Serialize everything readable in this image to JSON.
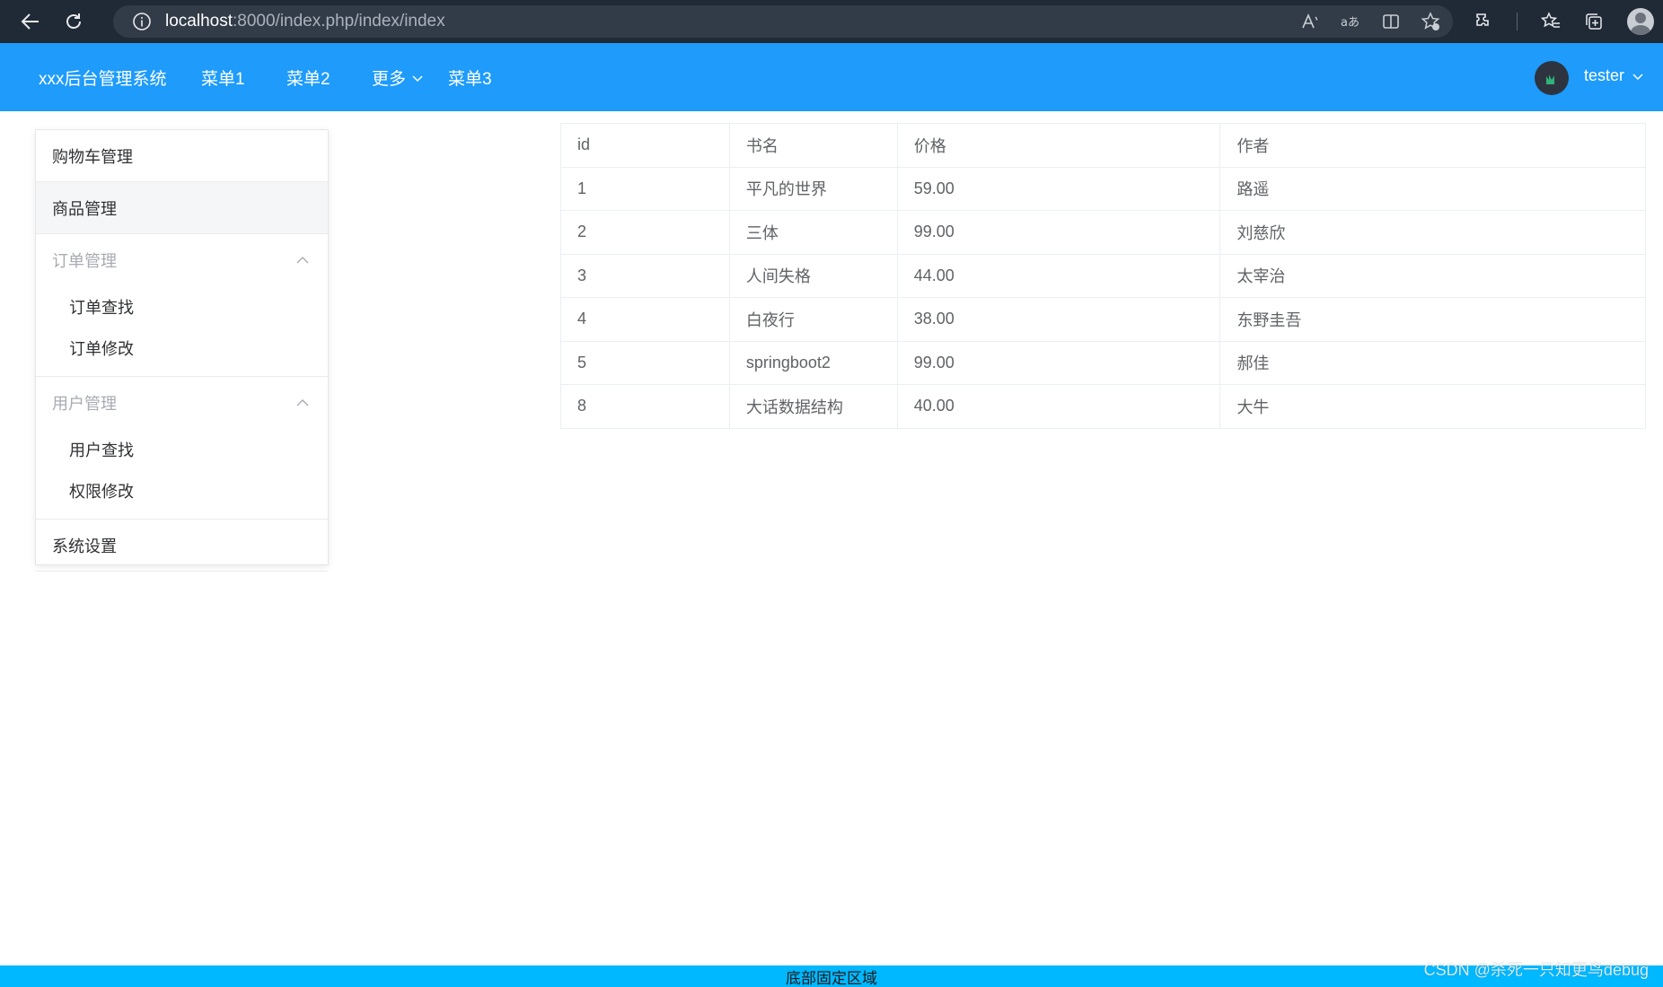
{
  "browser": {
    "url_host": "localhost",
    "url_rest": ":8000/index.php/index/index"
  },
  "header": {
    "brand": "xxx后台管理系统",
    "menu": [
      "菜单1",
      "菜单2",
      "更多",
      "菜单3"
    ],
    "username": "tester",
    "color": "#1e9bfb"
  },
  "sidebar": {
    "items": [
      {
        "label": "购物车管理"
      },
      {
        "label": "商品管理"
      }
    ],
    "groups": [
      {
        "title": "订单管理",
        "children": [
          "订单查找",
          "订单修改"
        ]
      },
      {
        "title": "用户管理",
        "children": [
          "用户查找",
          "权限修改"
        ]
      }
    ],
    "last_item": "系统设置"
  },
  "table": {
    "columns": [
      "id",
      "书名",
      "价格",
      "作者"
    ],
    "rows": [
      [
        "1",
        "平凡的世界",
        "59.00",
        "路遥"
      ],
      [
        "2",
        "三体",
        "99.00",
        "刘慈欣"
      ],
      [
        "3",
        "人间失格",
        "44.00",
        "太宰治"
      ],
      [
        "4",
        "白夜行",
        "38.00",
        "东野圭吾"
      ],
      [
        "5",
        "springboot2",
        "99.00",
        "郝佳"
      ],
      [
        "8",
        "大话数据结构",
        "40.00",
        "大牛"
      ]
    ]
  },
  "footer": {
    "text": "底部固定区域",
    "color": "#00b8ff"
  },
  "watermark": "CSDN @杀死一只知更鸟debug"
}
